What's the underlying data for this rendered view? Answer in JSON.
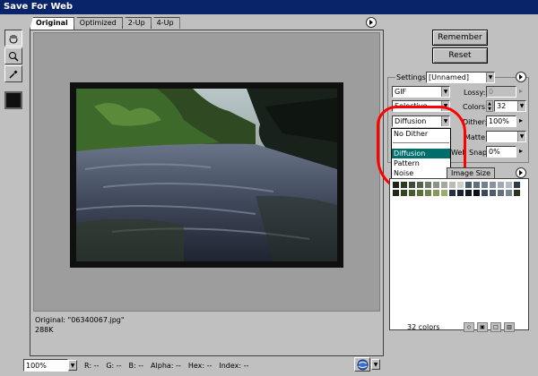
{
  "window": {
    "title": "Save For Web"
  },
  "tabs": [
    {
      "label": "Original"
    },
    {
      "label": "Optimized"
    },
    {
      "label": "2-Up"
    },
    {
      "label": "4-Up"
    }
  ],
  "preview": {
    "filename": "Original: \"06340067.jpg\"",
    "size": "288K"
  },
  "buttons": {
    "remember": "Remember",
    "reset": "Reset"
  },
  "settings": {
    "label": "Settings:",
    "preset": "[Unnamed]",
    "format": "GIF",
    "lossy_label": "Lossy:",
    "lossy_value": "0",
    "reduction": "Selective",
    "colors_label": "Colors:",
    "colors_value": "32",
    "dither_algo": "Diffusion",
    "dither_label": "Dither:",
    "dither_value": "100%",
    "matte_label": "Matte:",
    "websnap_label": "Web Snap:",
    "websnap_value": "0%"
  },
  "dither_menu": {
    "items": [
      "No Dither",
      "Diffusion",
      "Pattern",
      "Noise"
    ],
    "selected": "Diffusion"
  },
  "color_table": {
    "tab_label": "Image Size",
    "count_label": "32 colors",
    "swatches": [
      "#1a2314",
      "#2c3a24",
      "#3d4a3c",
      "#55604d",
      "#6c7a66",
      "#8b9586",
      "#a3aa9d",
      "#b9beb4",
      "#cdd0c9",
      "#4a5d6a",
      "#5e6f7f",
      "#73808e",
      "#8893a0",
      "#9fa8b4",
      "#b3bac4",
      "#2e3b4a",
      "#20281c",
      "#364424",
      "#475a30",
      "#5b6e3e",
      "#6f834e",
      "#84985f",
      "#98ac70",
      "#253040",
      "#1a2230",
      "#111a24",
      "#0b1018",
      "#3a4858",
      "#4e5c6c",
      "#627080",
      "#76848f",
      "#2a3420"
    ]
  },
  "statusbar": {
    "zoom": "100%",
    "r": "R:   --",
    "g": "G:   --",
    "b": "B:   --",
    "alpha": "Alpha:  --",
    "hex": "Hex:   --",
    "index": "Index:  --"
  }
}
